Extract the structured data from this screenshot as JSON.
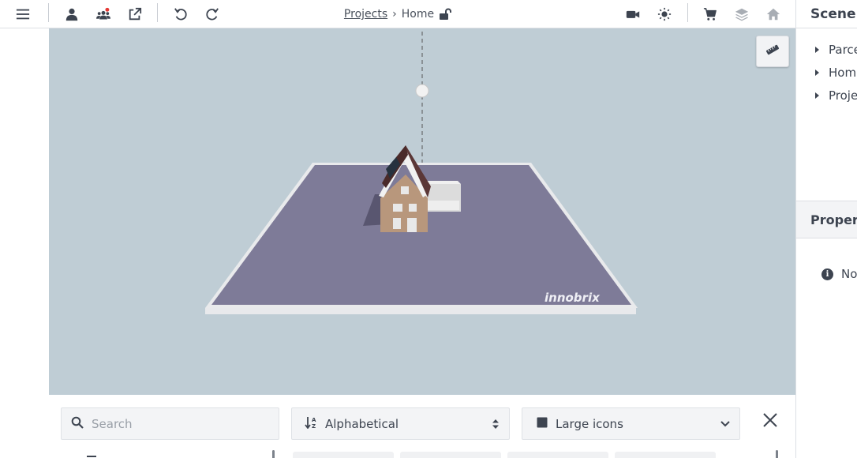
{
  "toolbar": {
    "breadcrumb": {
      "projects": "Projects",
      "separator": "›",
      "current": "Home"
    },
    "left_icons": [
      "menu-icon",
      "user-icon",
      "team-icon",
      "share-external-icon",
      "undo-icon",
      "redo-icon"
    ],
    "right_icons": [
      "camera-icon",
      "sun-icon",
      "cart-icon",
      "layers-icon",
      "home-icon"
    ],
    "team_notification_color": "#e53935"
  },
  "viewport": {
    "background": "#bfcdd5",
    "plot_color": "#7e7b98",
    "watermark": "innobrix",
    "ruler_icon": "ruler-icon"
  },
  "scene_panel": {
    "title": "Scene",
    "items": [
      {
        "label": "Parcel"
      },
      {
        "label": "Home"
      },
      {
        "label": "Project"
      }
    ]
  },
  "properties_panel": {
    "title": "Properties",
    "message": "No selection"
  },
  "catalog": {
    "search_placeholder": "Search",
    "sort_label": "Alphabetical",
    "view_label": "Large icons"
  }
}
